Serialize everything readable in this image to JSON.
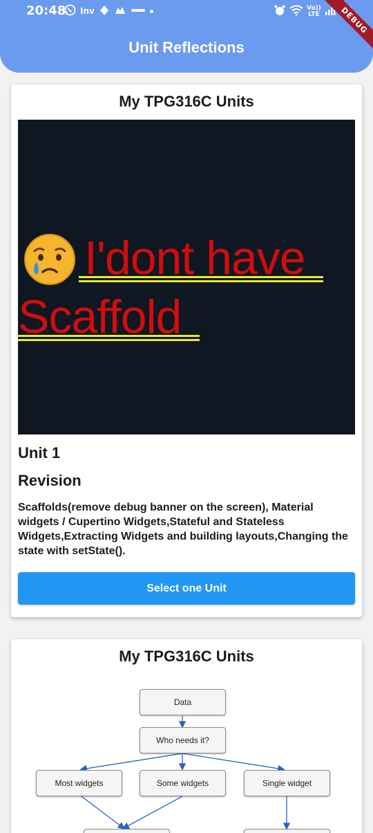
{
  "status_bar": {
    "time": "20:48",
    "left_icons": [
      "whatsapp-icon",
      "inv-icon",
      "app-icon",
      "app-icon",
      "app-icon"
    ],
    "inv_label": "Inv",
    "right_icons": [
      "alarm-icon",
      "wifi-icon",
      "volte-icon",
      "signal-icon",
      "battery-icon"
    ],
    "volte_top": "Vo))",
    "volte_bottom": "LTE"
  },
  "debug_banner": "DEBUG",
  "app_bar": {
    "title": "Unit Reflections",
    "color": "#6b9bef"
  },
  "cards": [
    {
      "title": "My TPG316C Units",
      "image": {
        "line1": "I'dont have",
        "line2": "Scaffold",
        "emoji": "crying-face-icon"
      },
      "heading": "Unit 1",
      "subheading": "Revision",
      "description": "Scaffolds(remove debug banner on the screen), Material widgets / Cupertino Widgets,Stateful and Stateless Widgets,Extracting Widgets and building layouts,Changing the state with setState().",
      "button_label": "Select one Unit",
      "button_color": "#2196f3"
    },
    {
      "title": "My TPG316C Units",
      "diagram": {
        "nodes": [
          "Data",
          "Who needs it?",
          "Most widgets",
          "Some widgets",
          "Single widget"
        ]
      }
    }
  ]
}
